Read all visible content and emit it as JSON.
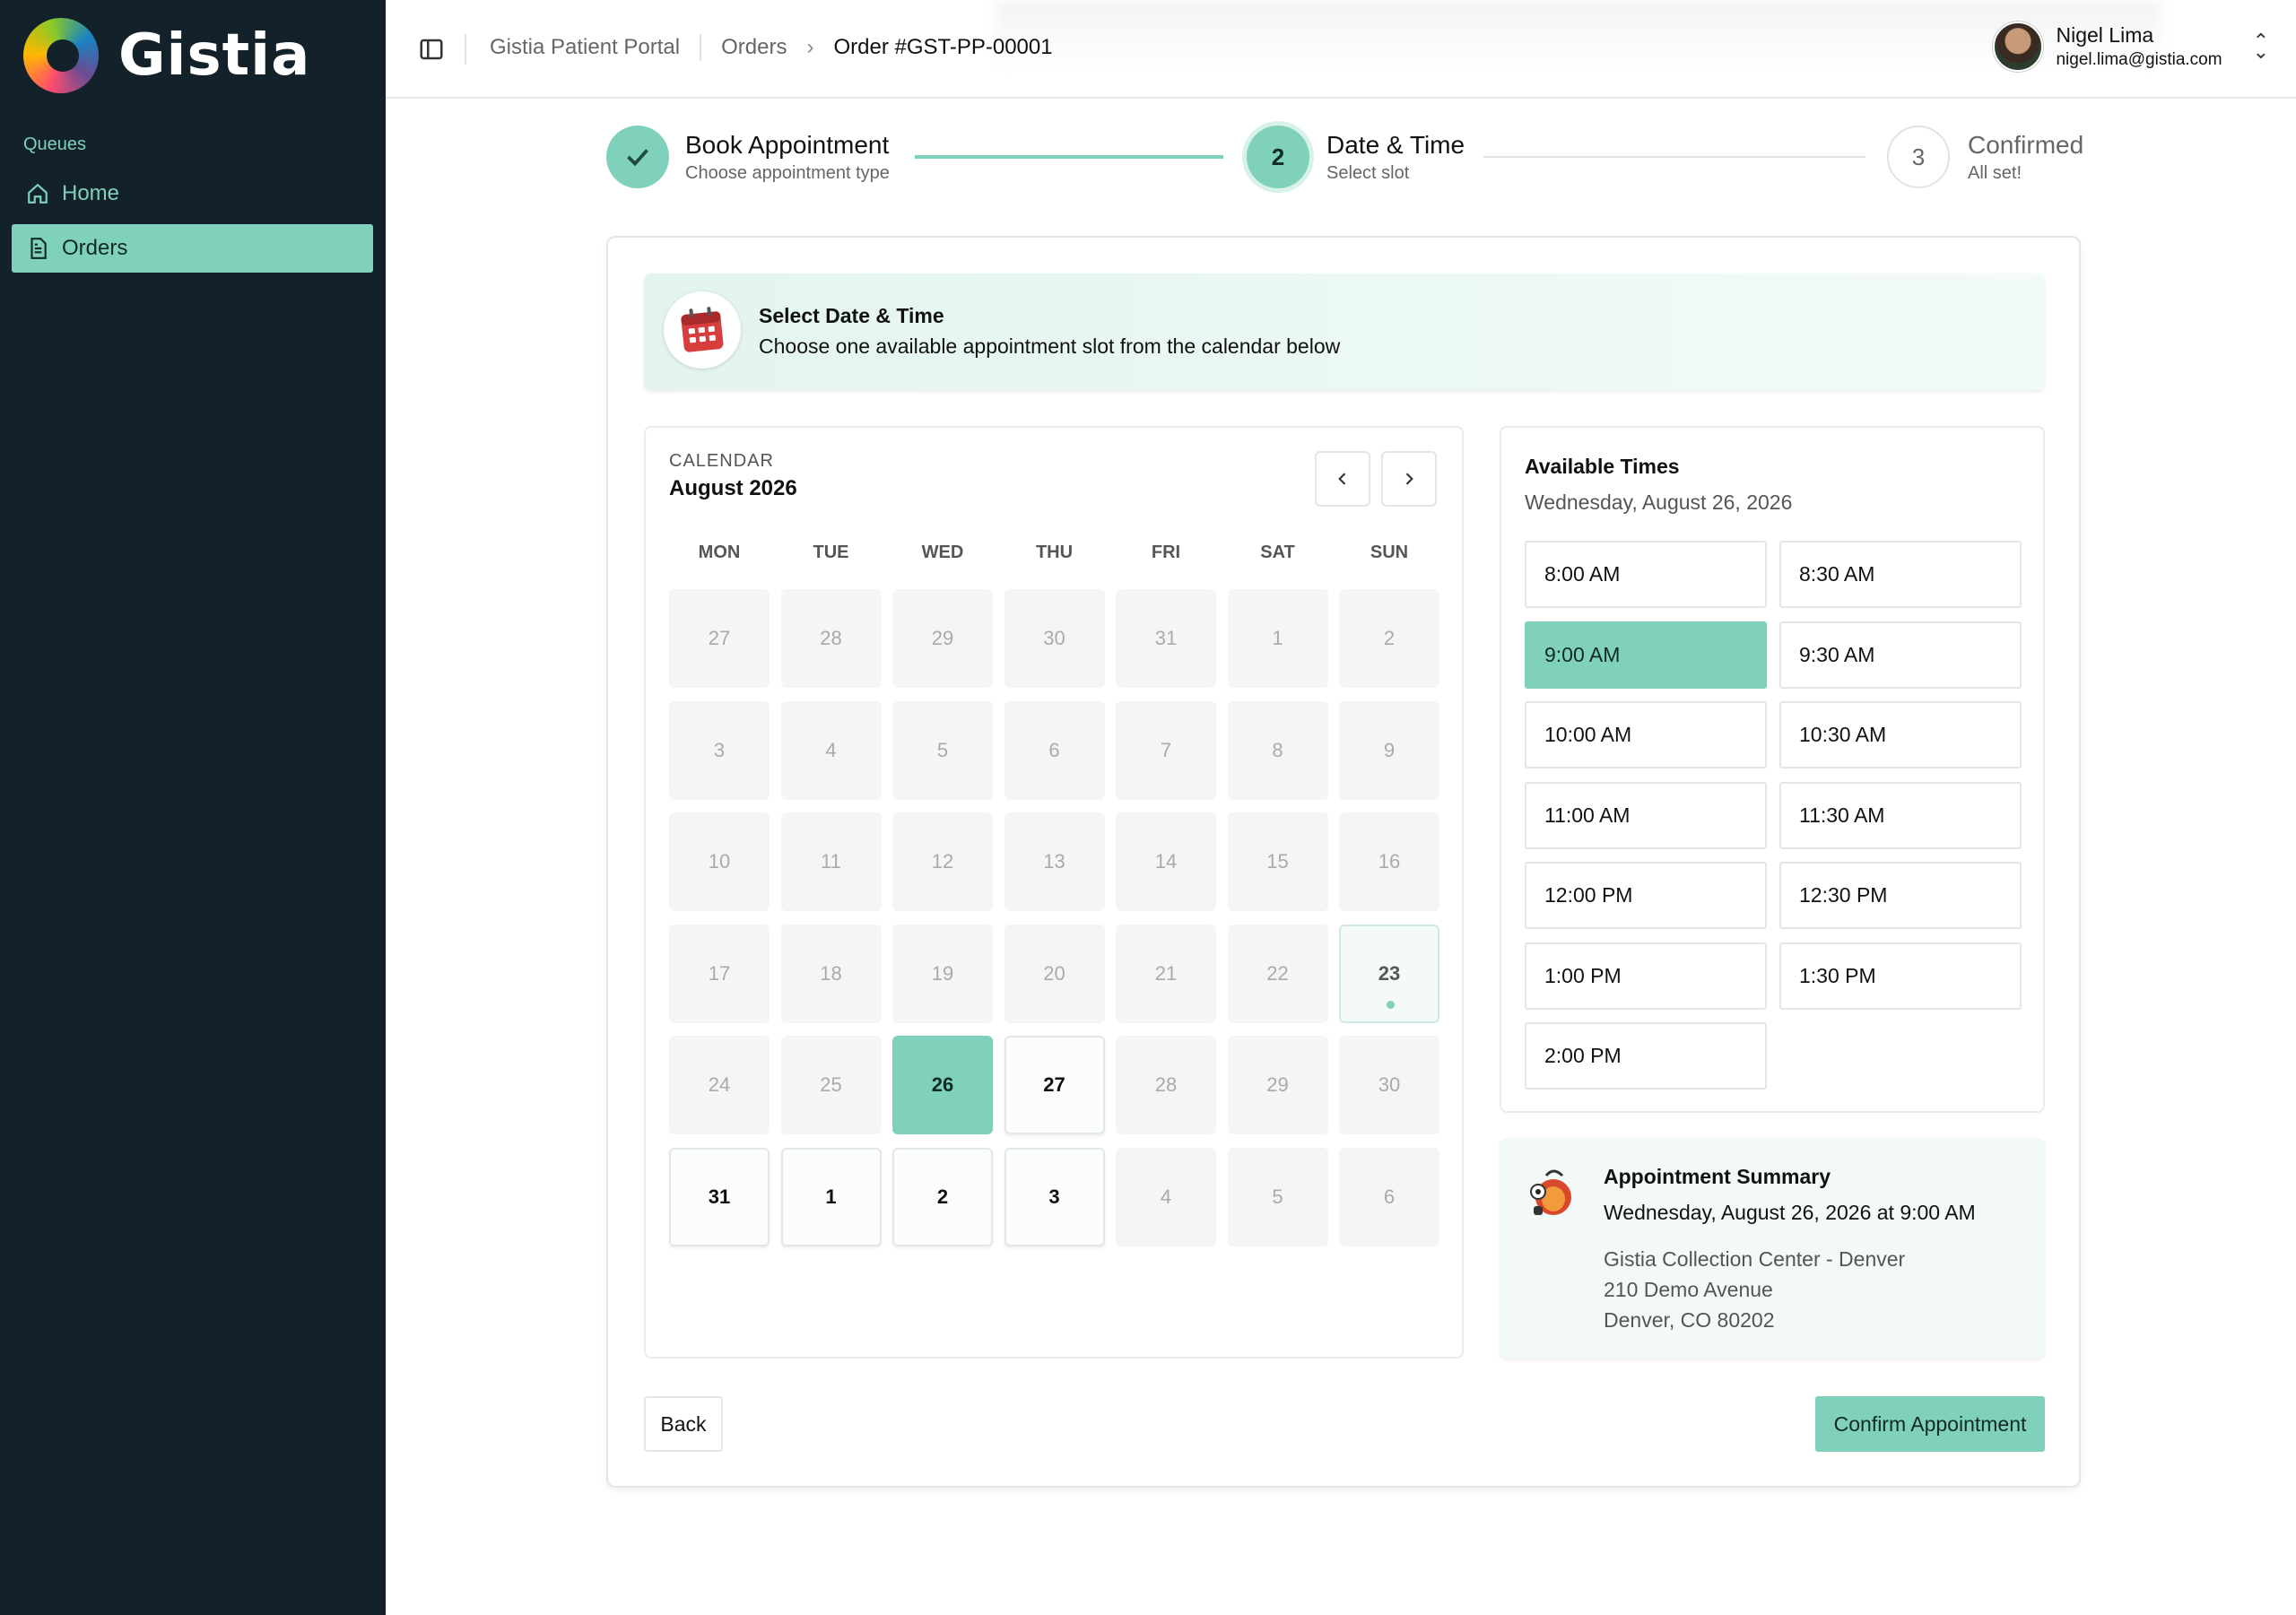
{
  "sidebar": {
    "brand": "Gistia",
    "section_label": "Queues",
    "items": [
      {
        "label": "Home",
        "icon": "home-icon",
        "active": false
      },
      {
        "label": "Orders",
        "icon": "document-icon",
        "active": true
      }
    ]
  },
  "breadcrumb": [
    "Gistia Patient Portal",
    "Orders",
    "Order #GST-PP-00001"
  ],
  "user": {
    "name": "Nigel Lima",
    "email": "nigel.lima@gistia.com"
  },
  "stepper": [
    {
      "number": "1",
      "title": "Book Appointment",
      "subtitle": "Choose appointment type",
      "status": "done"
    },
    {
      "number": "2",
      "title": "Date & Time",
      "subtitle": "Select slot",
      "status": "current"
    },
    {
      "number": "3",
      "title": "Confirmed",
      "subtitle": "All set!",
      "status": "upcoming"
    }
  ],
  "banner": {
    "title": "Select Date & Time",
    "subtitle": "Choose one available appointment slot from the calendar below"
  },
  "calendar": {
    "label": "CALENDAR",
    "month": "August 2026",
    "weekdays": [
      "MON",
      "TUE",
      "WED",
      "THU",
      "FRI",
      "SAT",
      "SUN"
    ],
    "weeks": [
      [
        "27",
        "28",
        "29",
        "30",
        "31",
        "1",
        "2"
      ],
      [
        "3",
        "4",
        "5",
        "6",
        "7",
        "8",
        "9"
      ],
      [
        "10",
        "11",
        "12",
        "13",
        "14",
        "15",
        "16"
      ],
      [
        "17",
        "18",
        "19",
        "20",
        "21",
        "22",
        "23"
      ],
      [
        "24",
        "25",
        "26",
        "27",
        "28",
        "29",
        "30"
      ],
      [
        "31",
        "1",
        "2",
        "3",
        "4",
        "5",
        "6"
      ]
    ],
    "today": "23",
    "selected": "26",
    "available": [
      "27",
      "31",
      "1",
      "2",
      "3"
    ]
  },
  "times": {
    "title": "Available Times",
    "date": "Wednesday, August 26, 2026",
    "slots": [
      "8:00 AM",
      "8:30 AM",
      "9:00 AM",
      "9:30 AM",
      "10:00 AM",
      "10:30 AM",
      "11:00 AM",
      "11:30 AM",
      "12:00 PM",
      "12:30 PM",
      "1:00 PM",
      "1:30 PM",
      "2:00 PM"
    ],
    "selected": "9:00 AM"
  },
  "summary": {
    "title": "Appointment Summary",
    "when": "Wednesday, August 26, 2026 at 9:00 AM",
    "address": [
      "Gistia Collection Center - Denver",
      "210 Demo Avenue",
      "Denver, CO 80202"
    ]
  },
  "buttons": {
    "back": "Back",
    "confirm": "Confirm Appointment"
  },
  "colors": {
    "sidebar": "#12212a",
    "accent": "#7fd1bb"
  }
}
